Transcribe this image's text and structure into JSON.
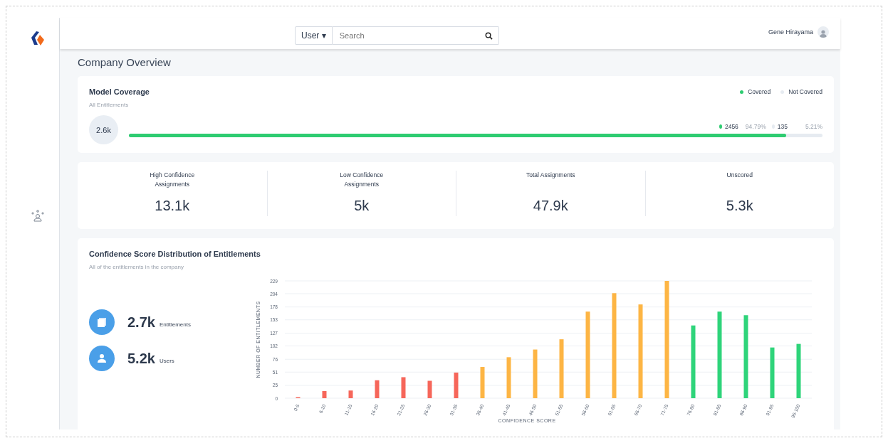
{
  "header": {
    "search_scope": "User",
    "scope_caret": "▾",
    "search": {
      "placeholder": "Search"
    },
    "user_name": "Gene Hirayama"
  },
  "page_title": "Company Overview",
  "model_coverage": {
    "title": "Model Coverage",
    "subtitle": "All Entitlements",
    "total": "2.6k",
    "level": 0.9479,
    "legend": [
      {
        "label": "Covered",
        "color": "#2ecc71"
      },
      {
        "label": "Not Covered",
        "color": "#e6ebf1"
      }
    ],
    "stats": [
      {
        "count": "2456",
        "percent": "94.79%",
        "color": "#2ecc71"
      },
      {
        "count": "135",
        "percent": "5.21%",
        "color": "#e6ebf1"
      }
    ]
  },
  "kpis": [
    {
      "label": "High Confidence Assignments",
      "value": "13.1k"
    },
    {
      "label": "Low Confidence Assignments",
      "value": "5k"
    },
    {
      "label": "Total Assignments",
      "value": "47.9k"
    },
    {
      "label": "Unscored",
      "value": "5.3k"
    }
  ],
  "distribution": {
    "title": "Confidence Score Distribution of Entitlements",
    "subtitle": "All of the entitlements in the company",
    "summary": [
      {
        "kind": "entitlements",
        "value": "2.7k",
        "label": "Entitlements"
      },
      {
        "kind": "users",
        "value": "5.2k",
        "label": "Users"
      }
    ],
    "chart_data": {
      "type": "bar",
      "xlabel": "CONFIDENCE SCORE",
      "ylabel": "NUMBER OF ENTITLEMENTS",
      "categories": [
        "0-5",
        "6-10",
        "11-15",
        "16-20",
        "21-25",
        "26-30",
        "31-35",
        "36-40",
        "41-45",
        "46-50",
        "51-55",
        "56-60",
        "61-65",
        "66-70",
        "71-75",
        "76-80",
        "81-85",
        "86-90",
        "91-95",
        "96-100"
      ],
      "series": [
        {
          "color": "#f6665a",
          "values": [
            2,
            14,
            15,
            35,
            41,
            34,
            50,
            null,
            null,
            null,
            null,
            null,
            null,
            null,
            null,
            null,
            null,
            null,
            null,
            null
          ]
        },
        {
          "color": "#fdb544",
          "values": [
            null,
            null,
            null,
            null,
            null,
            null,
            null,
            61,
            80,
            95,
            115,
            169,
            205,
            183,
            229,
            null,
            null,
            null,
            null,
            null
          ]
        },
        {
          "color": "#2ed47a",
          "values": [
            null,
            null,
            null,
            null,
            null,
            null,
            null,
            null,
            null,
            null,
            null,
            null,
            null,
            null,
            null,
            142,
            169,
            162,
            99,
            106
          ]
        }
      ],
      "ylim": [
        0,
        229
      ],
      "grid": true,
      "yticks": [
        0,
        25,
        51,
        76,
        102,
        127,
        153,
        178,
        204,
        229
      ]
    }
  }
}
